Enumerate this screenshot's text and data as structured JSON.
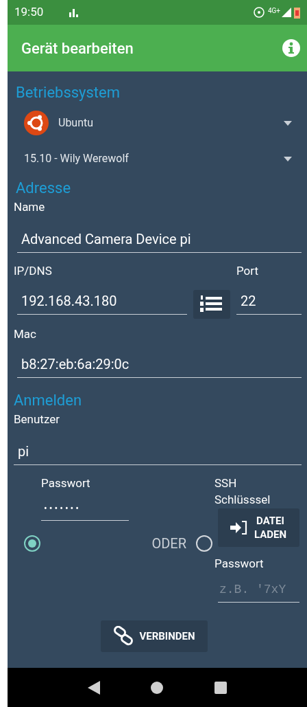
{
  "status_bar": {
    "time": "19:50",
    "network": "4G+"
  },
  "app_bar": {
    "title": "Gerät bearbeiten"
  },
  "os_section": {
    "heading": "Betriebssystem",
    "os": "Ubuntu",
    "version": "15.10 - Wily Werewolf"
  },
  "address_section": {
    "heading": "Adresse",
    "name_label": "Name",
    "name_value": "Advanced Camera Device pi",
    "ip_label": "IP/DNS",
    "ip_value": "192.168.43.180",
    "port_label": "Port",
    "port_value": "22",
    "mac_label": "Mac",
    "mac_value": "b8:27:eb:6a:29:0c"
  },
  "login_section": {
    "heading": "Anmelden",
    "user_label": "Benutzer",
    "user_value": "pi",
    "password_label": "Passwort",
    "password_value": "•••••••",
    "ssh_label": "SSH Schlüsssel",
    "load_button": "DATEI LADEN",
    "or_label": "ODER",
    "key_password_label": "Passwort",
    "key_password_placeholder": "z.B. '7xY",
    "radios": [
      {
        "selected": true
      },
      {
        "selected": false
      }
    ]
  },
  "connect_button": "VERBINDEN"
}
